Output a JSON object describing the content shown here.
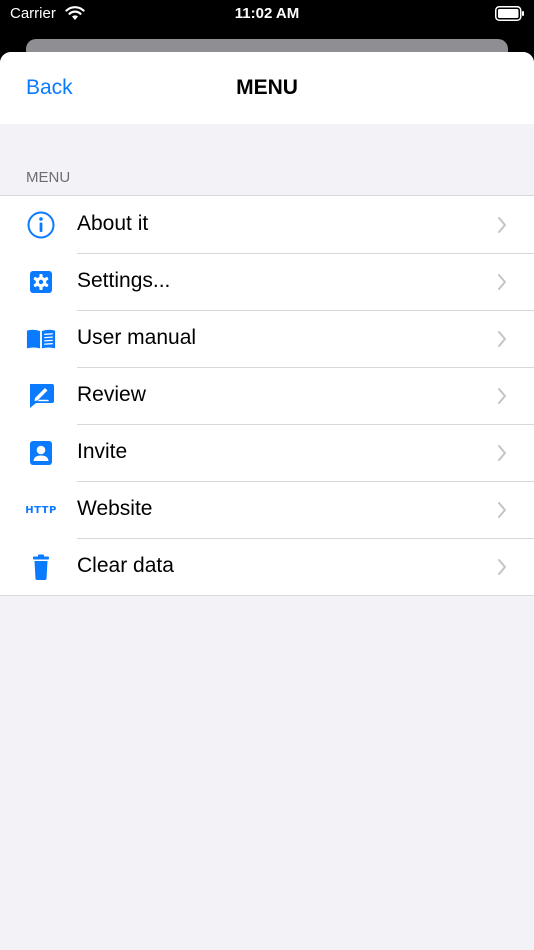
{
  "status_bar": {
    "carrier": "Carrier",
    "time": "11:02 AM"
  },
  "nav": {
    "back_label": "Back",
    "title": "MENU"
  },
  "section": {
    "header": "MENU"
  },
  "menu_items": [
    {
      "label": "About it",
      "icon": "info-icon"
    },
    {
      "label": "Settings...",
      "icon": "gear-icon"
    },
    {
      "label": "User manual",
      "icon": "book-icon"
    },
    {
      "label": "Review",
      "icon": "review-icon"
    },
    {
      "label": "Invite",
      "icon": "contact-icon"
    },
    {
      "label": "Website",
      "icon": "http-icon",
      "icon_text": "HTTP"
    },
    {
      "label": "Clear data",
      "icon": "trash-icon"
    }
  ],
  "colors": {
    "accent": "#0a7aff",
    "background": "#f2f2f7",
    "separator": "#d8d8dc",
    "chevron": "#c4c4c7"
  }
}
